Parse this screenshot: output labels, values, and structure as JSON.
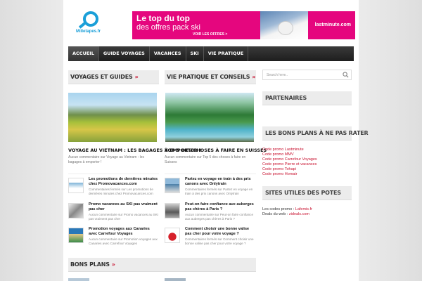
{
  "header": {
    "logo_text_a": "Mille",
    "logo_text_b": "tapes.fr",
    "banner": {
      "line1": "Le top du top",
      "line2": "des offres pack ski",
      "cta": "VOIR LES OFFRES >",
      "brand": "lastminute.com",
      "color": "#e5067e"
    }
  },
  "nav": {
    "items": [
      "ACCUEIL",
      "GUIDE VOYAGES",
      "VACANCES",
      "SKI",
      "VIE PRATIQUE"
    ]
  },
  "col1": {
    "head": "VOYAGES ET GUIDES",
    "arrow": "»",
    "feature": {
      "title": "VOYAGE AU VIETNAM : LES BAGAGES À EMPORTER !",
      "meta": "Aucun commentaire sur Voyage au Vietnam : les bagages à emporter !"
    },
    "items": [
      {
        "title": "Les promotions de dernières minutes chez Promovacances.com",
        "meta": "Commentaires fermés sur Les promotions de dernières minutes chez Promovacances.com"
      },
      {
        "title": "Promo vacances au SKI pas vraiment pas cher",
        "meta": "Aucun commentaire sur Promo vacances au SKI pas vraiment pas cher"
      },
      {
        "title": "Promotion voyages aux Canaries avec Carrefour Voyages",
        "meta": "Aucun commentaire sur Promotion voyages aux Canaries avec Carrefour Voyages"
      }
    ]
  },
  "col2": {
    "head": "VIE PRATIQUE ET CONSEILS",
    "arrow": "»",
    "feature": {
      "title": "TOP 5 DES CHOSES À FAIRE EN SUISSES",
      "meta": "Aucun commentaire sur Top 5 des choses à faire en Suisses"
    },
    "items": [
      {
        "title": "Partez en voyage en train à des prix canons avec Onlytrain",
        "meta": "Commentaires fermés sur Partez en voyage en train à des prix canons avec Onlytrain"
      },
      {
        "title": "Peut-on faire confiance aux auberges pas chères à Paris ?",
        "meta": "Aucun commentaire sur Peut-on faire confiance aux auberges pas chères à Paris ?"
      },
      {
        "title": "Comment choisir une bonne valise pas cher pour votre voyage ?",
        "meta": "Commentaires fermés sur Comment choisir une bonne valise pas cher pour votre voyage ?"
      }
    ]
  },
  "bons_plans": {
    "head": "BONS PLANS",
    "arrow": "»"
  },
  "sidebar": {
    "search_placeholder": "Search here..",
    "partenaires": "PARTENAIRES",
    "bons_plans_head": "LES BONS PLANS À NE PAS RATER",
    "links": [
      "Code promo Lastminute",
      "Code promo MMV",
      "Code promo Carrefour Voyages",
      "Code promo Pierre et vacances",
      "Code promo Tohapi",
      "Code promo Homair"
    ],
    "sites_head": "SITES UTILES DES POTES",
    "site1_label": "Les codes promo : ",
    "site1_link": "Lafemis.fr",
    "site2_label": "Deals du web : ",
    "site2_link": "zideals.com"
  },
  "colors": {
    "accent": "#c8102e",
    "nav": "#2b2b2b",
    "logo": "#1a9fd8"
  }
}
